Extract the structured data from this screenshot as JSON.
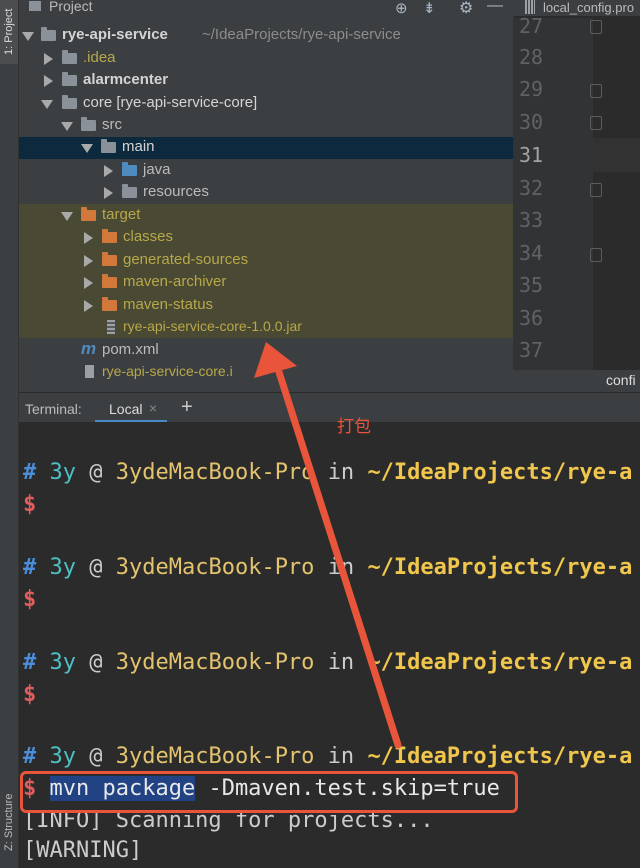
{
  "left_tabs": {
    "project": "1: Project",
    "structure": "Z: Structure"
  },
  "project_panel": {
    "title": "Project",
    "tree": [
      {
        "label": "rye-api-service",
        "suffix": "~/IdeaProjects/rye-api-service"
      },
      {
        "label": ".idea"
      },
      {
        "label": "alarmcenter"
      },
      {
        "label": "core [rye-api-service-core]"
      },
      {
        "label": "src"
      },
      {
        "label": "main"
      },
      {
        "label": "java"
      },
      {
        "label": "resources"
      },
      {
        "label": "target"
      },
      {
        "label": "classes"
      },
      {
        "label": "generated-sources"
      },
      {
        "label": "maven-archiver"
      },
      {
        "label": "maven-status"
      },
      {
        "label": "rye-api-service-core-1.0.0.jar"
      },
      {
        "label": "pom.xml"
      },
      {
        "label": "rye-api-service-core.i"
      }
    ]
  },
  "editor": {
    "tab": "local_config.pro",
    "line_numbers": [
      "27",
      "28",
      "29",
      "30",
      "31",
      "32",
      "33",
      "34",
      "35",
      "36",
      "37"
    ],
    "bottom_label": "confi"
  },
  "terminal": {
    "title": "Terminal:",
    "tab": "Local",
    "close": "×",
    "add": "+",
    "annotation": "打包",
    "prompt": {
      "hash": "#",
      "user": "3y",
      "at": "@",
      "host": "3ydeMacBook-Pro",
      "in": "in",
      "path": "~/IdeaProjects/rye-a",
      "dollar": "$"
    },
    "command_selected": "mvn package",
    "command_rest": " -Dmaven.test.skip=true",
    "info_line": "[INFO] Scanning for projects...",
    "warning_line": "[WARNING]"
  },
  "colors": {
    "annotation_red": "#e8553a",
    "selection_blue": "#0d293e",
    "target_yellow": "#494934"
  }
}
